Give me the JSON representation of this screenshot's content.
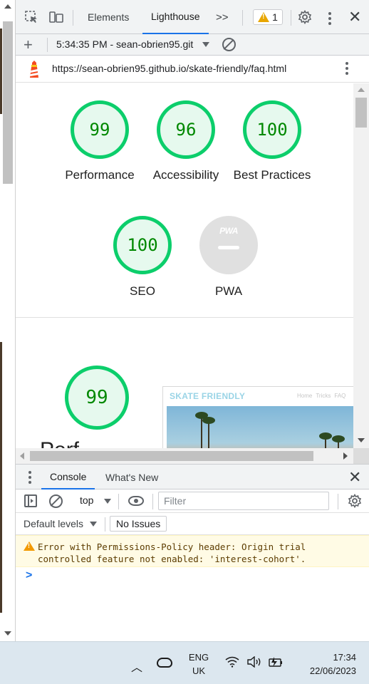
{
  "devtools": {
    "tabs": {
      "elements": "Elements",
      "lighthouse": "Lighthouse",
      "more": ">>"
    },
    "warning_count": "1"
  },
  "lighthouse_toolbar": {
    "report_label": "5:34:35 PM - sean-obrien95.git"
  },
  "report": {
    "url": "https://sean-obrien95.github.io/skate-friendly/faq.html",
    "gauges": [
      {
        "score": "99",
        "label": "Performance"
      },
      {
        "score": "96",
        "label": "Accessibility"
      },
      {
        "score": "100",
        "label": "Best Practices"
      },
      {
        "score": "100",
        "label": "SEO"
      },
      {
        "score": "",
        "label": "PWA",
        "badge": "PWA"
      }
    ],
    "perf_section": {
      "score": "99",
      "heading_partial": "Perf"
    },
    "screenshot": {
      "brand": "SKATE FRIENDLY",
      "nav": [
        "Home",
        "Tricks",
        "FAQ"
      ]
    }
  },
  "drawer": {
    "tabs": {
      "console": "Console",
      "whats_new": "What's New"
    },
    "context": "top",
    "filter_placeholder": "Filter",
    "levels": "Default levels",
    "issues": "No Issues",
    "warning_message": "Error with Permissions-Policy header: Origin trial\ncontrolled feature not enabled: 'interest-cohort'.",
    "prompt": ">"
  },
  "taskbar": {
    "lang_line1": "ENG",
    "lang_line2": "UK",
    "time": "17:34",
    "date": "22/06/2023"
  },
  "colors": {
    "pass_green": "#0cce6b",
    "pass_fill": "#e6f9ee",
    "score_text": "#008800",
    "accent_blue": "#1a73e8",
    "warning_bg": "#fffbe5"
  }
}
